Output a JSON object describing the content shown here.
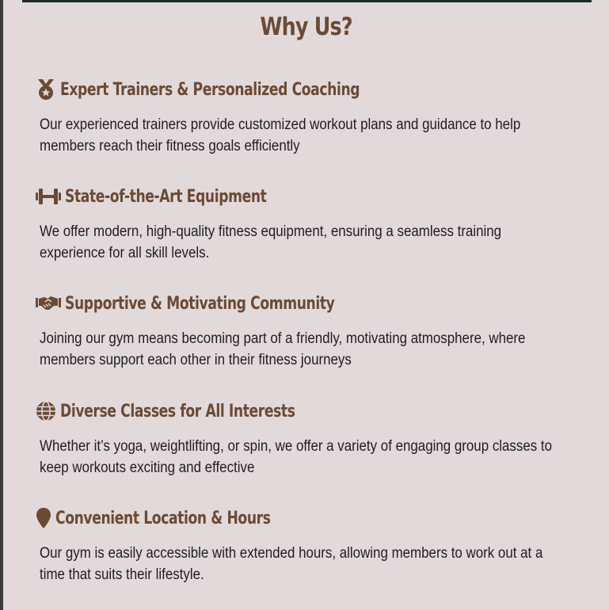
{
  "section": {
    "title": "Why Us?",
    "items": [
      {
        "icon": "medal-icon",
        "heading": "Expert Trainers & Personalized Coaching",
        "description": "Our experienced trainers provide customized workout plans and guidance to help members reach their fitness goals efficiently"
      },
      {
        "icon": "dumbbell-icon",
        "heading": "State-of-the-Art Equipment",
        "description": "We offer modern, high-quality fitness equipment, ensuring a seamless training experience for all skill levels."
      },
      {
        "icon": "handshake-icon",
        "heading": "Supportive & Motivating Community",
        "description": "Joining our gym means becoming part of a friendly, motivating atmosphere, where members support each other in their fitness journeys"
      },
      {
        "icon": "globe-icon",
        "heading": "Diverse Classes for All Interests",
        "description": "Whether it’s yoga, weightlifting, or spin, we offer a variety of engaging group classes to keep workouts exciting and effective"
      },
      {
        "icon": "location-pin-icon",
        "heading": "Convenient Location & Hours",
        "description": "Our gym is easily accessible with extended hours, allowing members to work out at a time that suits their lifestyle."
      }
    ]
  },
  "colors": {
    "background": "#e2d9da",
    "accent_brown": "#6b4a35",
    "text": "#1e1e1e"
  }
}
